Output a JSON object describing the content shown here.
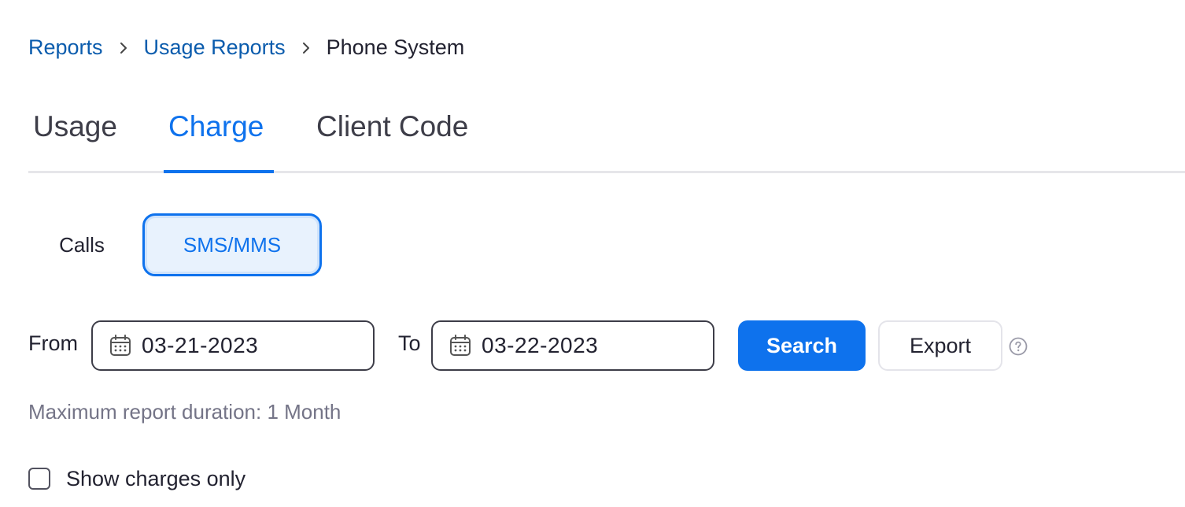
{
  "breadcrumb": {
    "items": [
      "Reports",
      "Usage Reports",
      "Phone System"
    ]
  },
  "tabs": {
    "items": [
      "Usage",
      "Charge",
      "Client Code"
    ],
    "active": "Charge"
  },
  "segment": {
    "calls": "Calls",
    "sms": "SMS/MMS",
    "selected": "SMS/MMS"
  },
  "filters": {
    "from_label": "From",
    "from_value": "03-21-2023",
    "to_label": "To",
    "to_value": "03-22-2023",
    "search_label": "Search",
    "export_label": "Export",
    "max_duration": "Maximum report duration: 1 Month",
    "show_charges_label": "Show charges only",
    "show_charges_checked": false
  },
  "icons": {
    "calendar": "calendar-icon",
    "help": "help-circle-icon",
    "chevron": "chevron-right-icon"
  },
  "colors": {
    "accent": "#0e72ed",
    "link": "#0b5cad",
    "muted": "#747487"
  }
}
